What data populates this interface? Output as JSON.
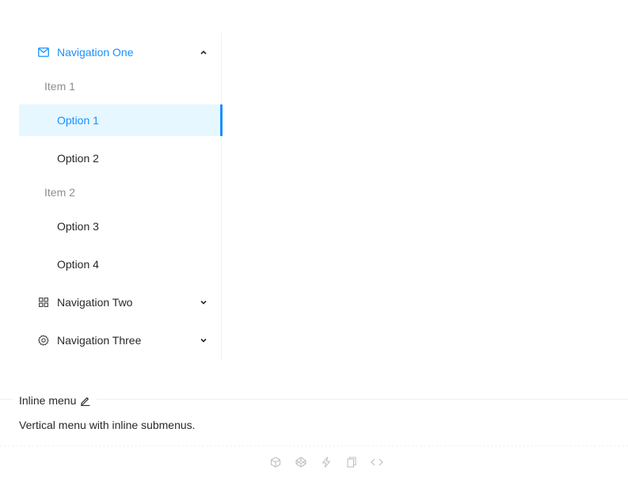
{
  "menu": {
    "nav_one": {
      "label": "Navigation One",
      "icon": "mail-icon",
      "expanded": true
    },
    "groups": [
      {
        "title": "Item 1",
        "options": [
          "Option 1",
          "Option 2"
        ]
      },
      {
        "title": "Item 2",
        "options": [
          "Option 3",
          "Option 4"
        ]
      }
    ],
    "selected_option": "Option 1",
    "nav_two": {
      "label": "Navigation Two",
      "icon": "appstore-icon",
      "expanded": false
    },
    "nav_three": {
      "label": "Navigation Three",
      "icon": "setting-icon",
      "expanded": false
    }
  },
  "demo": {
    "title": "Inline menu",
    "description": "Vertical menu with inline submenus.",
    "actions": [
      "codesandbox-icon",
      "codepen-icon",
      "thunderbolt-icon",
      "copy-icon",
      "code-icon"
    ]
  },
  "colors": {
    "accent": "#1890ff",
    "selected_bg": "#e6f7ff",
    "border": "#f0f0f0"
  }
}
